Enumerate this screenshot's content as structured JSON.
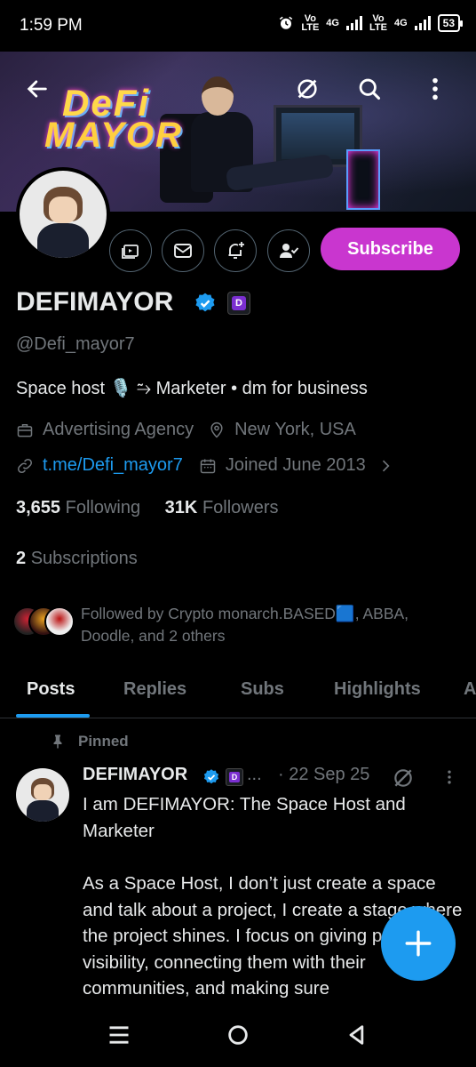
{
  "status_bar": {
    "time": "1:59 PM",
    "sim1_top": "Vo",
    "sim1_bottom": "LTE",
    "sim1_net": "4G",
    "sim2_top": "Vo",
    "sim2_bottom": "LTE",
    "sim2_net": "4G",
    "battery": "53"
  },
  "banner": {
    "logo_line1": "DeFi",
    "logo_line2": "MAYOR"
  },
  "profile": {
    "display_name": "DEFIMAYOR",
    "handle": "@Defi_mayor7",
    "bio": "Space host 🎙️ ⥲ Marketer  • dm for business",
    "category": "Advertising Agency",
    "location": "New York, USA",
    "link": "t.me/Defi_mayor7",
    "joined": "Joined June 2013",
    "following_count": "3,655",
    "following_label": "Following",
    "followers_count": "31K",
    "followers_label": "Followers",
    "subscriptions_count": "2",
    "subscriptions_label": "Subscriptions",
    "followed_by": "Followed by Crypto monarch.BASED🟦, ABBA, Doodle, and 2 others",
    "affiliate_badge": "D"
  },
  "actions": {
    "subscribe_label": "Subscribe"
  },
  "tabs": [
    {
      "label": "Posts",
      "active": true
    },
    {
      "label": "Replies",
      "active": false
    },
    {
      "label": "Subs",
      "active": false
    },
    {
      "label": "Highlights",
      "active": false
    },
    {
      "label": "A",
      "active": false
    }
  ],
  "post": {
    "pinned_label": "Pinned",
    "author": "DEFIMAYOR",
    "ellipsis": "...",
    "date": "· 22 Sep 25",
    "paragraph1": "I am DEFIMAYOR: The Space Host and Marketer",
    "paragraph2": "As a Space Host, I don’t just create a space and talk about a project, I create a stage where the project shines. I focus on giving projects visibility, connecting them with their communities, and making sure"
  },
  "colors": {
    "accent": "#1d9bf0",
    "subscribe": "#c936cf",
    "muted": "#71767b",
    "text": "#e7e9ea",
    "verified": "#1d9bf0"
  },
  "icons": {
    "back": "arrow-left-icon",
    "grok": "grok-icon",
    "search": "search-icon",
    "more": "more-vertical-icon",
    "creator": "creator-studio-icon",
    "message": "mail-icon",
    "notify": "bell-plus-icon",
    "following": "user-check-icon",
    "category": "briefcase-icon",
    "location": "location-pin-icon",
    "link": "link-icon",
    "calendar": "calendar-icon",
    "pin": "pin-icon",
    "compose": "plus-icon"
  }
}
